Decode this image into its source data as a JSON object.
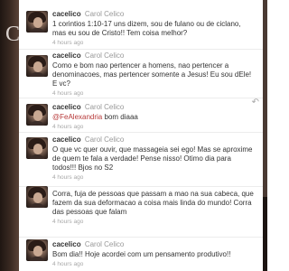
{
  "timeline": {
    "tweets": [
      {
        "username": "cacelico",
        "fullname": "Carol Celico",
        "text_plain": "1 corintios 1:10-17 uns dizem, sou de fulano ou de ciclano, mas eu sou de Cristo!! Tem coisa melhor?",
        "time": "4 hours ago"
      },
      {
        "username": "cacelico",
        "fullname": "Carol Celico",
        "text_plain": "Como e bom nao pertencer a homens, nao pertencer a denominacoes, mas pertencer somente a Jesus! Eu sou dEle! E vc?",
        "time": "4 hours ago"
      },
      {
        "username": "cacelico",
        "fullname": "Carol Celico",
        "mention": "@FeAlexandria",
        "text_after": " bom diaaa",
        "time": "4 hours ago",
        "reply_icon": "reply-icon"
      },
      {
        "username": "cacelico",
        "fullname": "Carol Celico",
        "text_plain": "O que vc quer ouvir, que massageia sei ego! Mas se aproxime de quem te fala a verdade! Pense nisso! Otimo dia para todos!!! Bjos no S2",
        "time": "4 hours ago"
      },
      {
        "username": "cacelico",
        "fullname": "Carol Celico",
        "text_plain": "Corra, fuja de pessoas que passam a mao na sua cabeca, que fazem da sua deformacao a coisa mais linda do mundo! Corra das pessoas que falam",
        "time": "4 hours ago"
      },
      {
        "username": "cacelico",
        "fullname": "Carol Celico",
        "text_plain": "Bom dia!! Hoje acordei com um pensamento produtivo!!",
        "time": "4 hours ago"
      }
    ]
  },
  "background": {
    "left_letter": "C"
  },
  "colors": {
    "username": "#333333",
    "fullname": "#999999",
    "text": "#333333",
    "mention": "#b73a3a",
    "time": "#a8a8a8"
  }
}
